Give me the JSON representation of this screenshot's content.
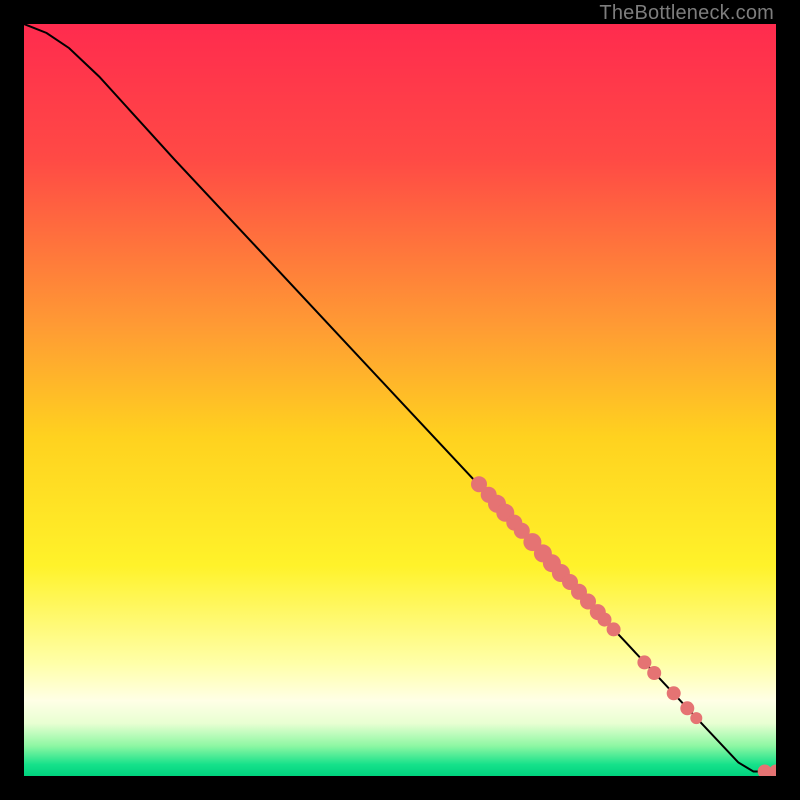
{
  "watermark": "TheBottleneck.com",
  "chart_data": {
    "type": "line",
    "title": "",
    "xlabel": "",
    "ylabel": "",
    "xlim": [
      0,
      100
    ],
    "ylim": [
      0,
      100
    ],
    "gradient_stops": [
      {
        "offset": 0.0,
        "color": "#ff2b4e"
      },
      {
        "offset": 0.18,
        "color": "#ff4a45"
      },
      {
        "offset": 0.4,
        "color": "#ff9a34"
      },
      {
        "offset": 0.55,
        "color": "#ffd21f"
      },
      {
        "offset": 0.72,
        "color": "#fff22a"
      },
      {
        "offset": 0.85,
        "color": "#ffffa8"
      },
      {
        "offset": 0.9,
        "color": "#ffffe6"
      },
      {
        "offset": 0.93,
        "color": "#e8ffd2"
      },
      {
        "offset": 0.96,
        "color": "#8df7a3"
      },
      {
        "offset": 0.985,
        "color": "#15e18a"
      },
      {
        "offset": 1.0,
        "color": "#00d27e"
      }
    ],
    "series": [
      {
        "name": "bottleneck-curve",
        "type": "line",
        "points": [
          {
            "x": 0.0,
            "y": 100.0
          },
          {
            "x": 3.0,
            "y": 98.8
          },
          {
            "x": 6.0,
            "y": 96.8
          },
          {
            "x": 10.0,
            "y": 93.0
          },
          {
            "x": 20.0,
            "y": 82.0
          },
          {
            "x": 30.0,
            "y": 71.3
          },
          {
            "x": 40.0,
            "y": 60.6
          },
          {
            "x": 50.0,
            "y": 49.9
          },
          {
            "x": 60.0,
            "y": 39.2
          },
          {
            "x": 70.0,
            "y": 28.5
          },
          {
            "x": 80.0,
            "y": 17.8
          },
          {
            "x": 90.0,
            "y": 7.1
          },
          {
            "x": 95.0,
            "y": 1.8
          },
          {
            "x": 97.0,
            "y": 0.6
          },
          {
            "x": 100.0,
            "y": 0.6
          }
        ]
      },
      {
        "name": "highlight-dots",
        "type": "scatter",
        "color": "#e57373",
        "points": [
          {
            "x": 60.5,
            "y": 38.8,
            "r": 8
          },
          {
            "x": 61.8,
            "y": 37.4,
            "r": 8
          },
          {
            "x": 62.9,
            "y": 36.2,
            "r": 9
          },
          {
            "x": 64.0,
            "y": 35.0,
            "r": 9
          },
          {
            "x": 65.2,
            "y": 33.7,
            "r": 8
          },
          {
            "x": 66.2,
            "y": 32.6,
            "r": 8
          },
          {
            "x": 67.6,
            "y": 31.1,
            "r": 9
          },
          {
            "x": 69.0,
            "y": 29.6,
            "r": 9
          },
          {
            "x": 70.2,
            "y": 28.3,
            "r": 9
          },
          {
            "x": 71.4,
            "y": 27.0,
            "r": 9
          },
          {
            "x": 72.6,
            "y": 25.8,
            "r": 8
          },
          {
            "x": 73.8,
            "y": 24.5,
            "r": 8
          },
          {
            "x": 75.0,
            "y": 23.2,
            "r": 8
          },
          {
            "x": 76.3,
            "y": 21.8,
            "r": 8
          },
          {
            "x": 77.2,
            "y": 20.8,
            "r": 7
          },
          {
            "x": 78.4,
            "y": 19.5,
            "r": 7
          },
          {
            "x": 82.5,
            "y": 15.1,
            "r": 7
          },
          {
            "x": 83.8,
            "y": 13.7,
            "r": 7
          },
          {
            "x": 86.4,
            "y": 11.0,
            "r": 7
          },
          {
            "x": 88.2,
            "y": 9.0,
            "r": 7
          },
          {
            "x": 89.4,
            "y": 7.7,
            "r": 6
          },
          {
            "x": 98.5,
            "y": 0.6,
            "r": 7
          },
          {
            "x": 100.0,
            "y": 0.6,
            "r": 7
          }
        ]
      }
    ]
  }
}
